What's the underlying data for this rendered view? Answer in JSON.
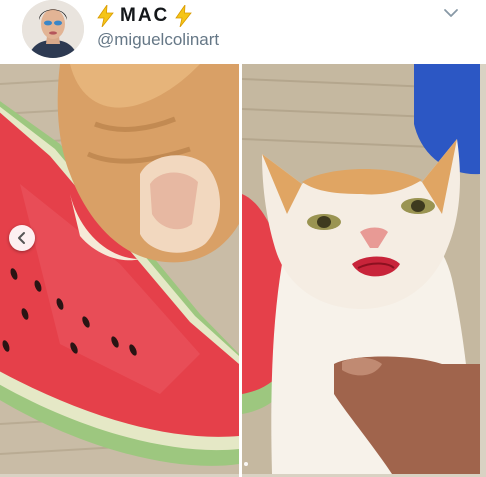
{
  "profile": {
    "display_name": "MAC",
    "handle": "@miguelcolinart"
  },
  "icons": {
    "left_emoji": "lightning-bolt",
    "right_emoji": "lightning-bolt",
    "menu": "chevron-down",
    "carousel_prev": "left-arrow"
  },
  "colors": {
    "name_text": "#14171a",
    "handle_text": "#657786",
    "bolt": "#f5c518",
    "watermelon_flesh": "#e5404a",
    "rind_green": "#9dc77f",
    "cat_orange": "#d9a066"
  },
  "carousel": {
    "images": [
      {
        "description_name": "cat-eating-watermelon"
      },
      {
        "description_name": "cat-with-red-mouth"
      }
    ],
    "active_index": 1
  }
}
